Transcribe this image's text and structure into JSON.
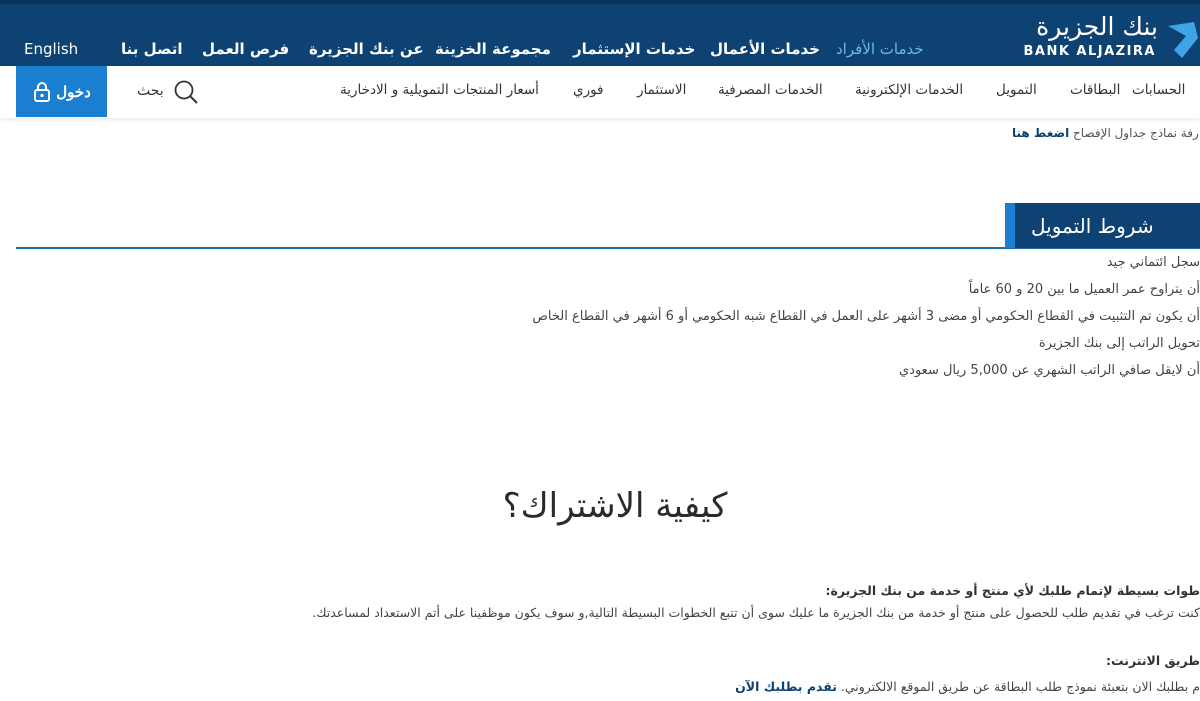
{
  "brand": {
    "name_ar": "بنك الجزيرة",
    "name_en": "BANK ALJAZIRA"
  },
  "top_nav": {
    "items": [
      "خدمات الأفراد",
      "خدمات الأعمال",
      "خدمات الإستثمار",
      "مجموعة الخزينة",
      "عن بنك الجزيرة",
      "فرص العمل",
      "اتصل بنا"
    ],
    "language": "English"
  },
  "sub_nav": {
    "items": [
      "الحسابات",
      "البطاقات",
      "التمويل",
      "الخدمات الإلكترونية",
      "الخدمات المصرفية",
      "الاستثمار",
      "فوري",
      "أسعار المنتجات التمويلية و الادخارية"
    ],
    "search_label": "بحث",
    "login_label": "دخول"
  },
  "disclosure": {
    "text": "رفة نماذج جداول الإفصاح ",
    "link": "اضغط هنا"
  },
  "financing_terms": {
    "title": "شروط التمويل",
    "items": [
      "سجل ائتماني جيد",
      "أن يتراوح عمر العميل ما بين 20 و 60 عاماً",
      "أن يكون تم التثبيت في القطاع الحكومي أو مضى 3 أشهر على العمل في القطاع شبه الحكومي أو 6 أشهر في القطاع الخاص",
      "تحويل الراتب إلى بنك الجزيرة",
      "أن لايقل صافي الراتب الشهري عن 5,000 ريال سعودي"
    ]
  },
  "how_to_apply": {
    "title": "كيفية الاشتراك؟",
    "intro_heading": "طوات بسيطة لإتمام طلبك لأي منتج أو خدمة من بنك الجزيرة:",
    "intro_text": "كنت ترغب في تقديم طلب للحصول على منتج أو خدمة من بنك الجزيرة ما عليك سوى أن تتبع الخطوات البسيطة التالية,و سوف يكون موظفينا على أتم الاستعداد لمساعدتك.",
    "online_heading": "طريق الانترنت:",
    "online_text": "م بطلبك الان بتعبئة نموذج طلب البطاقة عن طريق الموقع الالكتروني. ",
    "online_link": "تقدم بطلبك الآن"
  }
}
